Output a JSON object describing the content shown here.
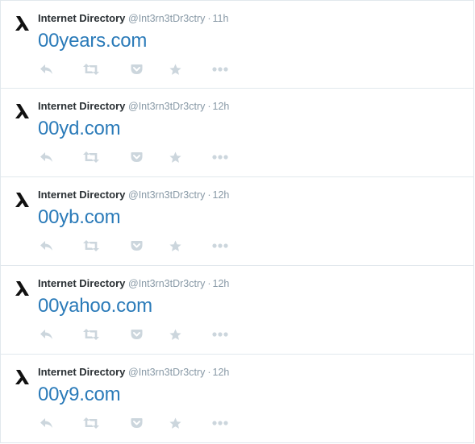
{
  "tweets": [
    {
      "name": "Internet Directory",
      "handle": "@Int3rn3tDr3ctry",
      "separator": "·",
      "time": "11h",
      "text": "00years.com"
    },
    {
      "name": "Internet Directory",
      "handle": "@Int3rn3tDr3ctry",
      "separator": "·",
      "time": "12h",
      "text": "00yd.com"
    },
    {
      "name": "Internet Directory",
      "handle": "@Int3rn3tDr3ctry",
      "separator": "·",
      "time": "12h",
      "text": "00yb.com"
    },
    {
      "name": "Internet Directory",
      "handle": "@Int3rn3tDr3ctry",
      "separator": "·",
      "time": "12h",
      "text": "00yahoo.com"
    },
    {
      "name": "Internet Directory",
      "handle": "@Int3rn3tDr3ctry",
      "separator": "·",
      "time": "12h",
      "text": "00y9.com"
    }
  ],
  "icons": {
    "avatar": "lambda-logo-icon",
    "actions": [
      "reply-icon",
      "retweet-icon",
      "pocket-icon",
      "favorite-star-icon",
      "more-dots-icon"
    ]
  },
  "colors": {
    "link": "#2b7bb9",
    "name": "#292f33",
    "meta": "#8899a6",
    "action_icon": "#ccd6dd",
    "divider": "#e1e8ed"
  }
}
